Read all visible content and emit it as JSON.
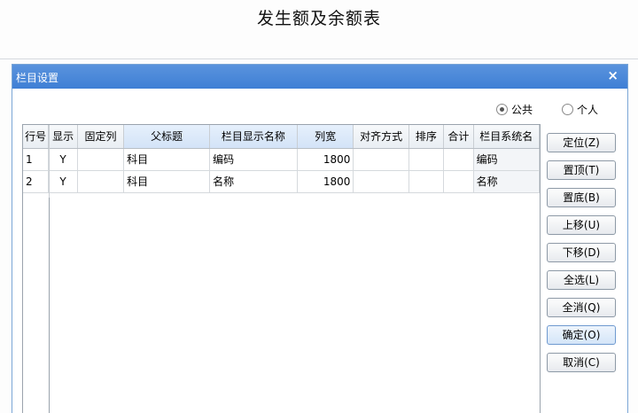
{
  "background": {
    "title": "发生额及余额表"
  },
  "dialog": {
    "title": "栏目设置",
    "close_label": "×",
    "radios": [
      {
        "label": "公共",
        "checked": true
      },
      {
        "label": "个人",
        "checked": false
      }
    ],
    "table": {
      "columns": [
        "行号",
        "显示",
        "固定列",
        "父标题",
        "栏目显示名称",
        "列宽",
        "对齐方式",
        "排序",
        "合计",
        "栏目系统名"
      ],
      "rows": [
        [
          "1",
          "Y",
          "",
          "科目",
          "编码",
          "1800",
          "",
          "",
          "",
          "编码"
        ],
        [
          "2",
          "Y",
          "",
          "科目",
          "名称",
          "1800",
          "",
          "",
          "",
          "名称"
        ]
      ]
    },
    "buttons": [
      "定位(Z)",
      "置顶(T)",
      "置底(B)",
      "上移(U)",
      "下移(D)",
      "全选(L)",
      "全消(Q)",
      "确定(O)",
      "取消(C)"
    ]
  },
  "colors": {
    "titlebar": "#3f7fd5",
    "header_selected": "#d3e3f7"
  }
}
